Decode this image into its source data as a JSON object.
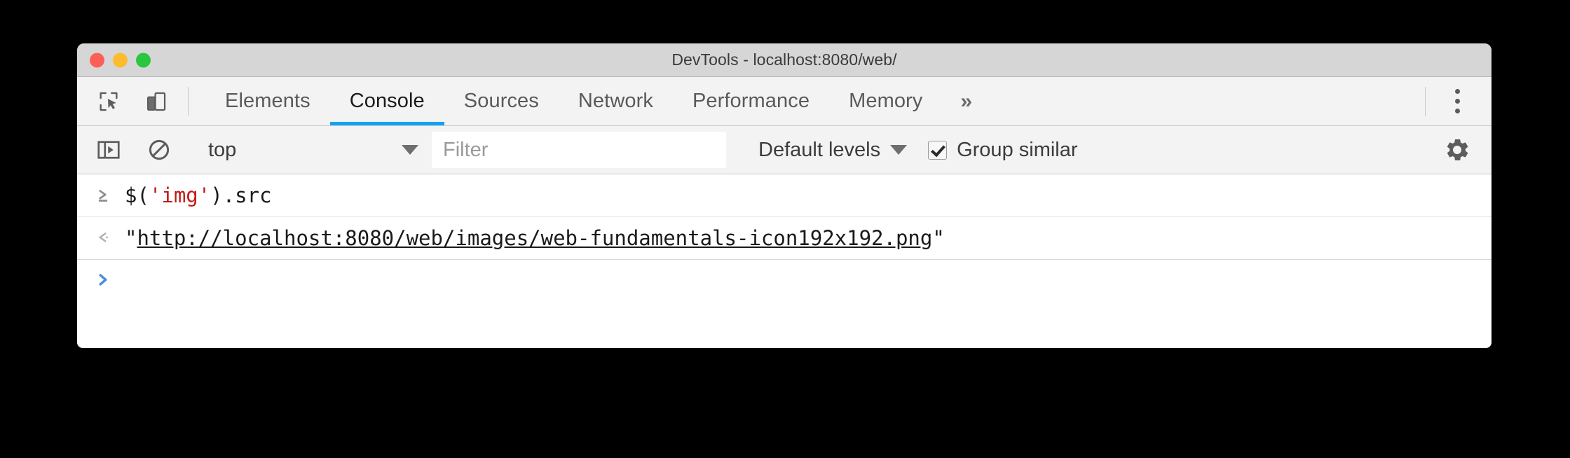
{
  "window": {
    "title": "DevTools - localhost:8080/web/",
    "traffic_lights": [
      {
        "name": "close",
        "color": "#fc5f57"
      },
      {
        "name": "minimize",
        "color": "#fdbc2e"
      },
      {
        "name": "zoom",
        "color": "#29c73f"
      }
    ]
  },
  "tabbar": {
    "left_icons": [
      {
        "name": "inspect-element-icon",
        "title": "Inspect element"
      },
      {
        "name": "device-toolbar-icon",
        "title": "Toggle device toolbar"
      }
    ],
    "tabs": [
      {
        "label": "Elements",
        "active": false
      },
      {
        "label": "Console",
        "active": true
      },
      {
        "label": "Sources",
        "active": false
      },
      {
        "label": "Network",
        "active": false
      },
      {
        "label": "Performance",
        "active": false
      },
      {
        "label": "Memory",
        "active": false
      }
    ],
    "overflow_label": "»",
    "more_menu_icon": "vertical-dots-icon",
    "active_underline_color": "#11a2f3"
  },
  "console_toolbar": {
    "sidebar_toggle_icon": "console-sidebar-icon",
    "clear_console_icon": "clear-console-icon",
    "context": {
      "selected": "top"
    },
    "filter": {
      "value": "",
      "placeholder": "Filter"
    },
    "levels": {
      "label": "Default levels"
    },
    "group_similar": {
      "label": "Group similar",
      "checked": true
    },
    "settings_icon": "gear-icon"
  },
  "console": {
    "messages": [
      {
        "kind": "input",
        "gutter_icon": "input-chevron-icon",
        "code_prefix": "$(",
        "code_string": "'img'",
        "code_suffix": ").src"
      },
      {
        "kind": "result",
        "gutter_icon": "output-chevron-icon",
        "quote_open": "\"",
        "url": "http://localhost:8080/web/images/web-fundamentals-icon192x192.png",
        "quote_close": "\""
      }
    ],
    "prompt": {
      "gutter_icon": "prompt-chevron-icon",
      "value": "",
      "color": "#4a90d9"
    }
  }
}
